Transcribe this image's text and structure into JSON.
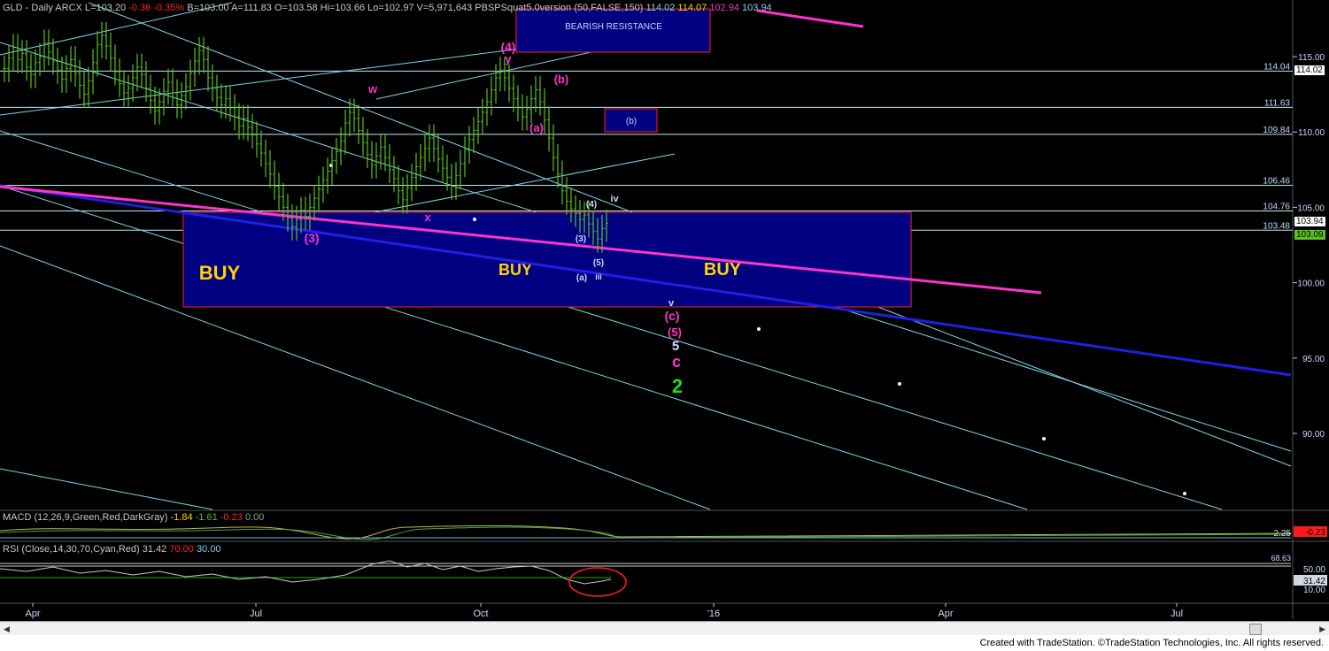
{
  "header": {
    "symbol": "GLD - Daily",
    "exchange": "ARCX",
    "last": "L=103.20",
    "change": "-0.36",
    "change_pct": "-0.35%",
    "bid": "B=103.00",
    "ask": "A=111.83",
    "open": "O=103.58",
    "high": "Hi=103.66",
    "low": "Lo=102.97",
    "volume": "V=5,971,643",
    "indicator": "PBSPSquat5.0version (50,FALSE,150)",
    "ind_v1": "114.02",
    "ind_v2": "114.07",
    "ind_v3": "102.94",
    "ind_v4": "103.94"
  },
  "macd_header": {
    "title": "MACD (12,26,9,Green,Red,DarkGray)",
    "v1": "-1.84",
    "v2": "-1.61",
    "v3": "-0.23",
    "v4": "0.00"
  },
  "rsi_header": {
    "title": "RSI (Close,14,30,70,Cyan,Red)",
    "v1": "31.42",
    "v2": "70.00",
    "v3": "30.00"
  },
  "footer": "Created with TradeStation. ©TradeStation Technologies, Inc. All rights reserved.",
  "colors": {
    "bg": "#000000",
    "cyan": "#7fd4e6",
    "magenta": "#ff33cc",
    "blue": "#1f1fe6",
    "green": "#59c21b",
    "box": "#000080",
    "boxBorder": "#ff2020",
    "yellow": "#ffd400",
    "white": "#ffffff"
  },
  "chart_data": {
    "type": "bar",
    "title": "GLD - Daily",
    "y_ticks": [
      115.0,
      110.0,
      105.0,
      100.0,
      95.0,
      90.0
    ],
    "x_ticks": [
      "Apr",
      "Jul",
      "Oct",
      "'16",
      "Apr",
      "Jul"
    ],
    "horizontal_levels": [
      114.04,
      111.63,
      109.84,
      106.46,
      104.76,
      103.48
    ],
    "price_labels": [
      {
        "value": 114.02,
        "text": "114.02",
        "bg": "#ffffff",
        "fg": "#000000"
      },
      {
        "value": 103.94,
        "text": "103.94",
        "bg": "#ffffff",
        "fg": "#000000"
      },
      {
        "value": 103.09,
        "text": "103.09",
        "bg": "#59c21b",
        "fg": "#000000"
      }
    ],
    "zones": [
      {
        "label": "BEARISH RESISTANCE"
      },
      {
        "label": "(b)"
      },
      {
        "label": "BUY",
        "texts": [
          "BUY",
          "BUY",
          "BUY"
        ]
      }
    ],
    "wave_labels": [
      {
        "text": "(4)",
        "color": "#ff33cc"
      },
      {
        "text": "y",
        "color": "#ff33cc"
      },
      {
        "text": "w",
        "color": "#ff33cc"
      },
      {
        "text": "x",
        "color": "#ff33cc"
      },
      {
        "text": "(b)",
        "color": "#ff33cc"
      },
      {
        "text": "(a)",
        "color": "#ff33cc"
      },
      {
        "text": "(3)",
        "color": "#ff33cc"
      },
      {
        "text": "iv",
        "color": "#c8d8ff"
      },
      {
        "text": "(4)",
        "color": "#c8d8ff"
      },
      {
        "text": "(3)",
        "color": "#c8d8ff"
      },
      {
        "text": "(5)",
        "color": "#c8d8ff"
      },
      {
        "text": "(a)",
        "color": "#c8d8ff"
      },
      {
        "text": "iii",
        "color": "#c8d8ff"
      },
      {
        "text": "v",
        "color": "#c8d8ff"
      },
      {
        "text": "(c)",
        "color": "#ff33cc"
      },
      {
        "text": "(5)",
        "color": "#ff33cc"
      },
      {
        "text": "5",
        "color": "#c8d8ff"
      },
      {
        "text": "c",
        "color": "#ff33cc"
      },
      {
        "text": "2",
        "color": "#22dd22"
      }
    ],
    "ohlc_closes": [
      114.2,
      114.9,
      115.6,
      114.8,
      115.2,
      114.3,
      113.8,
      114.6,
      115.0,
      115.9,
      115.3,
      114.7,
      114.1,
      113.5,
      114.2,
      114.8,
      113.9,
      113.1,
      112.5,
      113.4,
      114.6,
      115.8,
      116.4,
      115.7,
      114.9,
      114.0,
      113.2,
      112.6,
      112.9,
      113.6,
      114.3,
      113.8,
      112.9,
      112.1,
      111.4,
      112.0,
      112.7,
      113.3,
      112.6,
      111.8,
      112.4,
      113.0,
      113.9,
      114.7,
      115.4,
      114.8,
      113.6,
      112.9,
      112.3,
      111.8,
      112.2,
      111.6,
      111.0,
      110.4,
      110.9,
      110.3,
      109.8,
      109.2,
      108.6,
      107.9,
      107.2,
      106.4,
      105.7,
      105.0,
      104.3,
      103.7,
      104.2,
      104.8,
      104.4,
      105.0,
      105.6,
      106.2,
      106.8,
      107.4,
      108.1,
      108.7,
      109.4,
      110.6,
      111.3,
      110.9,
      110.1,
      109.3,
      108.5,
      107.8,
      108.4,
      109.0,
      108.3,
      107.5,
      106.9,
      106.1,
      105.5,
      106.3,
      107.0,
      107.7,
      108.3,
      108.9,
      109.6,
      108.9,
      108.2,
      107.6,
      107.0,
      106.4,
      107.1,
      107.9,
      108.8,
      109.5,
      110.1,
      110.7,
      111.3,
      112.0,
      112.8,
      113.6,
      114.1,
      113.6,
      112.9,
      112.2,
      111.6,
      111.0,
      111.5,
      112.2,
      112.8,
      112.0,
      110.8,
      109.6,
      108.3,
      107.2,
      106.1,
      105.4,
      104.9,
      104.6,
      104.2,
      104.5,
      103.9,
      103.4,
      102.9,
      103.6,
      103.94
    ],
    "macd": {
      "values": [
        -1.84,
        -1.61,
        -0.23,
        0.0
      ],
      "right_labels": [
        "-2.25",
        "-0.23"
      ]
    },
    "rsi": {
      "values": [
        31.42,
        70.0,
        30.0
      ],
      "axis_labels": [
        "68.63",
        "50.00",
        "31.42",
        "10.00"
      ]
    }
  }
}
